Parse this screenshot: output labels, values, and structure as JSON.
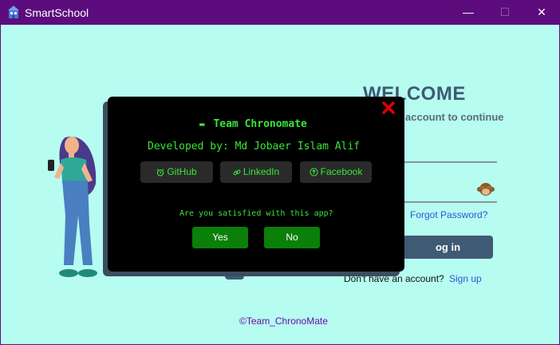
{
  "window": {
    "title": "SmartSchool",
    "minimize": "—",
    "maximize": "☐",
    "close": "✕"
  },
  "login": {
    "welcome": "WELCOME",
    "subtitle": "account to continue",
    "forgot": "Forgot Password?",
    "login_button": "og in",
    "no_account": "Don't have an account?",
    "signup": "Sign up",
    "footer": "©Team_ChronoMate"
  },
  "dialog": {
    "title": "Team Chronomate",
    "developer": "Developed by: Md Jobaer Islam Alif",
    "links": [
      {
        "label": "GitHub",
        "icon": "alarm-clock-icon"
      },
      {
        "label": "LinkedIn",
        "icon": "link-icon"
      },
      {
        "label": "Facebook",
        "icon": "upload-circle-icon"
      }
    ],
    "question": "Are you satisfied with this app?",
    "yes": "Yes",
    "no": "No",
    "accent_color": "#39e639",
    "button_color": "#0a7f0a",
    "close_color": "#e60000"
  },
  "colors": {
    "background": "#b6fcf1",
    "titlebar": "#5c0c7c",
    "primary": "#3f5a73"
  }
}
